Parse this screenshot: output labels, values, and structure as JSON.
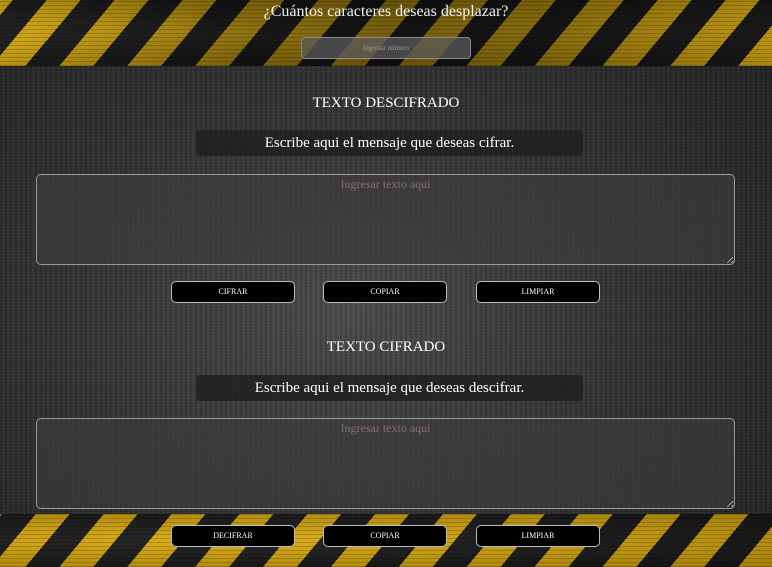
{
  "shift": {
    "question": "¿Cuántos caracteres deseas desplazar?",
    "placeholder": "Ingresar número"
  },
  "decrypt_section": {
    "title": "TEXTO DESCIFRADO",
    "instruction": "Escribe aqui el mensaje que deseas cifrar.",
    "textarea_placeholder": "Ingresar texto aqui",
    "buttons": {
      "primary": "CIFRAR",
      "copy": "COPIAR",
      "clear": "LIMPIAR"
    }
  },
  "encrypt_section": {
    "title": "TEXTO CIFRADO",
    "instruction": "Escribe aqui el mensaje que deseas descifrar.",
    "textarea_placeholder": "Ingresar texto aqui",
    "buttons": {
      "primary": "DECIFRAR",
      "copy": "COPIAR",
      "clear": "LIMPIAR"
    }
  },
  "colors": {
    "stripe_yellow": "#e2b10f",
    "stripe_black": "#1a1a1a",
    "button_bg": "#000000",
    "background": "#333333"
  }
}
